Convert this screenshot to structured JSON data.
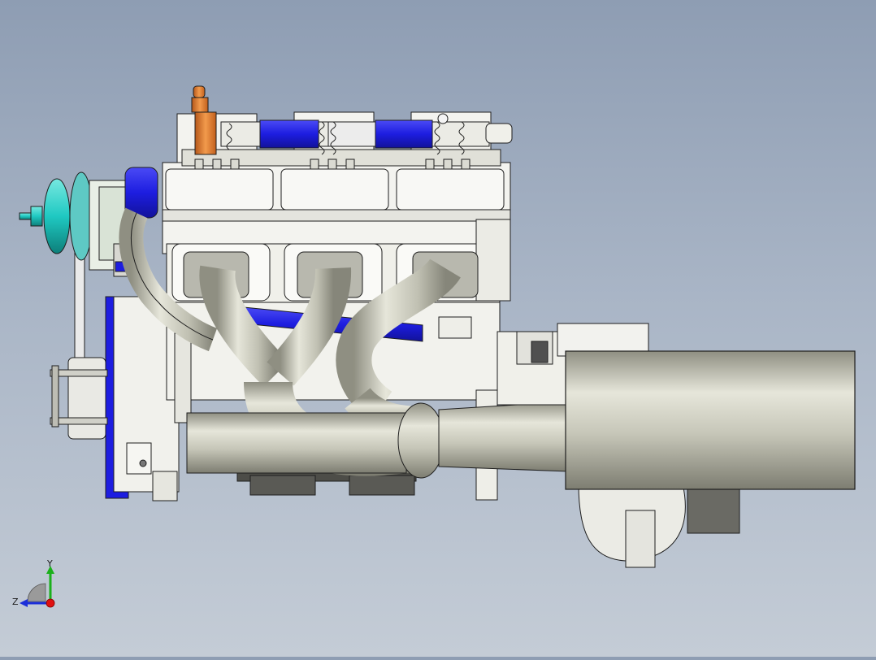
{
  "viewport": {
    "background_top": "#8e9db3",
    "background_bottom": "#c4ccd6"
  },
  "model": {
    "colors": {
      "block": "#f3f3ef",
      "block_shade": "#dcdcd6",
      "edge": "#1e1e1e",
      "hose_blue": "#1d1de0",
      "pipe_light": "#dcdcd0",
      "pipe_mid": "#b9b9ab",
      "pipe_dark": "#8f8f82",
      "flange": "#b8b8ae",
      "orange": "#e07a22",
      "cyan": "#1fc9c2",
      "mount_dark": "#4d4d48"
    }
  },
  "triad": {
    "y_label": "Y",
    "z_label": "Z",
    "y_color": "#1bb01b",
    "z_color": "#1c2fd9",
    "x_color": "#e01010"
  }
}
